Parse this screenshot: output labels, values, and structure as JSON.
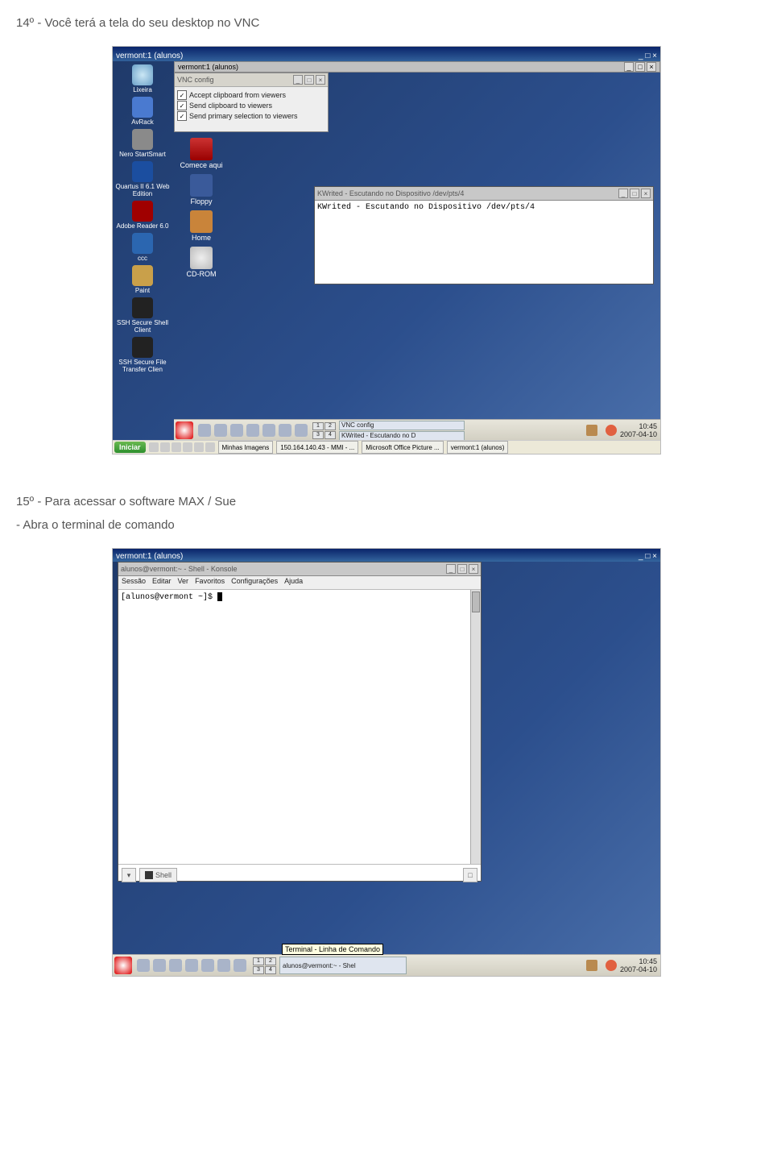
{
  "step14": "14º - Você terá a tela do seu desktop no VNC",
  "step15": "15º - Para acessar o software MAX / Sue",
  "step15b": "- Abra o terminal de comando",
  "shot1": {
    "outer_title": "vermont:1 (alunos)",
    "outer_ctrl": [
      "_",
      "□",
      "×"
    ],
    "kde_inner_title": "vermont:1 (alunos)",
    "vnc_config_title": "VNC config",
    "vnc_cb1": "Accept clipboard from viewers",
    "vnc_cb2": "Send clipboard to viewers",
    "vnc_cb3": "Send primary selection to viewers",
    "kwrited_title": "KWrited - Escutando no Dispositivo /dev/pts/4",
    "kwrited_body": "KWrited - Escutando no Dispositivo /dev/pts/4",
    "kde_icons": {
      "start": "Comece aqui",
      "floppy": "Floppy",
      "home": "Home",
      "cdrom": "CD-ROM"
    },
    "xp_icons": [
      "Lixeira",
      "AvRack",
      "Nero StartSmart",
      "Quartus II 6.1 Web Edition",
      "Adobe Reader 6.0",
      "ccc",
      "Paint",
      "SSH Secure Shell Client",
      "SSH Secure File Transfer Clien"
    ],
    "pager": [
      "1",
      "2",
      "3",
      "4"
    ],
    "task1": "VNC config",
    "task2": "KWrited - Escutando no D",
    "clock_time": "10:45",
    "clock_date": "2007-04-10",
    "xp_start": "Iniciar",
    "xp_tasks": [
      "Minhas Imagens",
      "150.164.140.43 - MMI - ...",
      "Microsoft Office Picture ...",
      "vermont:1 (alunos)"
    ]
  },
  "shot2": {
    "outer_title": "vermont:1 (alunos)",
    "konsole_title": "alunos@vermont:~ - Shell - Konsole",
    "menu": [
      "Sessão",
      "Editar",
      "Ver",
      "Favoritos",
      "Configurações",
      "Ajuda"
    ],
    "prompt": "[alunos@vermont ~]$ ",
    "tab_label": "Shell",
    "tooltip": "Terminal - Linha de Comando",
    "task": "alunos@vermont:~ - Shel",
    "pager": [
      "1",
      "2",
      "3",
      "4"
    ],
    "clock_time": "10:45",
    "clock_date": "2007-04-10"
  }
}
